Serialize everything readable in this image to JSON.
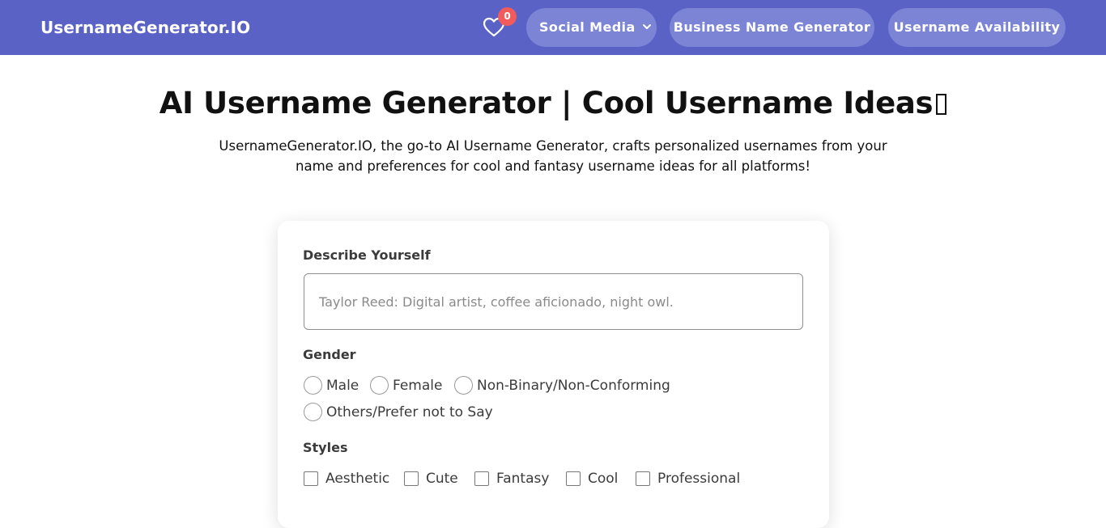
{
  "navbar": {
    "brand": "UsernameGenerator.IO",
    "favorites_count": "0",
    "social_media_label": "Social Media",
    "business_label": "Business Name Generator",
    "availability_label": "Username Availability"
  },
  "hero": {
    "title": "AI Username Generator | Cool Username Ideas",
    "description": "UsernameGenerator.IO, the go-to AI Username Generator, crafts personalized usernames from your name and preferences for cool and fantasy username ideas for all platforms!"
  },
  "form": {
    "describe_label": "Describe Yourself",
    "describe_placeholder": "Taylor Reed: Digital artist, coffee aficionado, night owl.",
    "gender_label": "Gender",
    "gender_options": [
      "Male",
      "Female",
      "Non-Binary/Non-Conforming",
      "Others/Prefer not to Say"
    ],
    "styles_label": "Styles",
    "style_options": [
      "Aesthetic",
      "Cute",
      "Fantasy",
      "Cool",
      "Professional"
    ]
  },
  "colors": {
    "navbar_bg": "#5a62c6",
    "pill_bg": "#7c84d6",
    "badge_bg": "#f15b5b"
  },
  "icons": {
    "favorites": "heart-icon",
    "dropdown": "chevron-down-icon",
    "title_glyph": "missing-glyph-icon"
  }
}
